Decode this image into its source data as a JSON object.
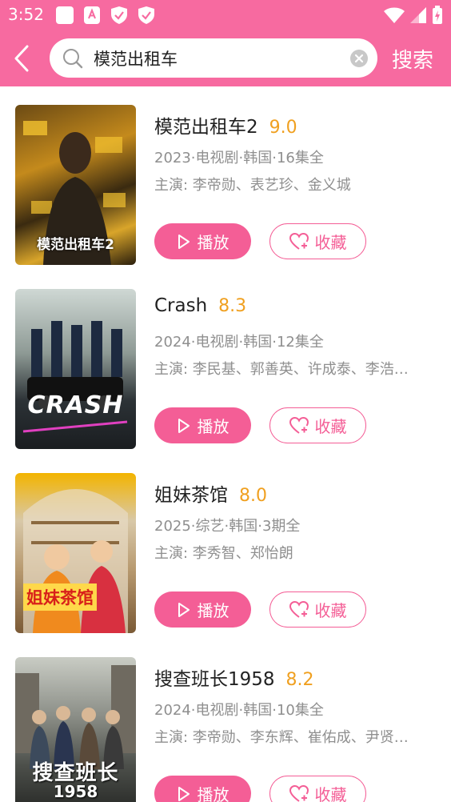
{
  "status_bar": {
    "time": "3:52"
  },
  "search": {
    "query": "模范出租车",
    "button_label": "搜索"
  },
  "colors": {
    "accent": "#f76aa0",
    "score": "#f0a020",
    "meta": "#8f8f8f"
  },
  "results": [
    {
      "title": "模范出租车2",
      "score": "9.0",
      "meta": "2023·电视剧·韩国·16集全",
      "cast": "主演: 李帝勋、表艺珍、金义城",
      "poster_text": "模范出租车2",
      "play_label": "播放",
      "fav_label": "收藏"
    },
    {
      "title": "Crash",
      "score": "8.3",
      "meta": "2024·电视剧·韩国·12集全",
      "cast": "主演: 李民基、郭善英、许成泰、李浩…",
      "poster_text": "CRASH",
      "play_label": "播放",
      "fav_label": "收藏"
    },
    {
      "title": "姐妹茶馆",
      "score": "8.0",
      "meta": "2025·综艺·韩国·3期全",
      "cast": "主演:  李秀智、郑怡朗",
      "poster_text": "姐妹茶馆",
      "play_label": "播放",
      "fav_label": "收藏"
    },
    {
      "title": "搜查班长1958",
      "score": "8.2",
      "meta": "2024·电视剧·韩国·10集全",
      "cast": "主演: 李帝勋、李东辉、崔佑成、尹贤…",
      "poster_text": "搜查班长",
      "poster_subtext": "1958",
      "play_label": "播放",
      "fav_label": "收藏"
    }
  ]
}
